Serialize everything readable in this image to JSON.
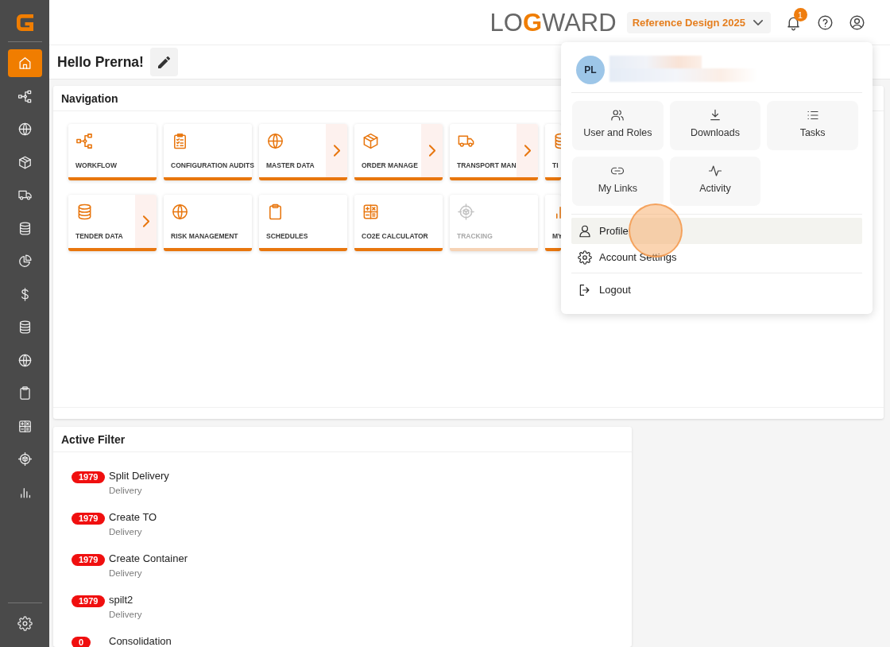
{
  "sidebar": {
    "items": [
      {
        "kind": "home",
        "selected": true
      },
      {
        "kind": "workflow",
        "selected": false
      },
      {
        "kind": "globe",
        "selected": false
      },
      {
        "kind": "box",
        "selected": false
      },
      {
        "kind": "truck",
        "selected": false
      },
      {
        "kind": "database",
        "selected": false
      },
      {
        "kind": "pie",
        "selected": false
      },
      {
        "kind": "dollar",
        "selected": false
      },
      {
        "kind": "database",
        "selected": false
      },
      {
        "kind": "globe",
        "selected": false
      },
      {
        "kind": "clipboard",
        "selected": false
      },
      {
        "kind": "calculator",
        "selected": false
      },
      {
        "kind": "target",
        "selected": false
      },
      {
        "kind": "chart",
        "selected": false
      }
    ],
    "bottom_items": [
      {
        "kind": "settings",
        "selected": false
      }
    ]
  },
  "header": {
    "logo": {
      "lead": "LO",
      "mark": "G",
      "tail": "WARD"
    },
    "project_select": {
      "value": "Reference Design 2025"
    },
    "notifications": {
      "badge": "1"
    }
  },
  "greeting": {
    "title": "Hello Prerna!"
  },
  "navigation": {
    "title": "Navigation",
    "tiles": [
      {
        "label": "WORKFLOW",
        "kind": "workflow",
        "submenu": false,
        "disabled": false
      },
      {
        "label": "CONFIGURATION AUDITS",
        "kind": "checklist",
        "submenu": false,
        "disabled": false
      },
      {
        "label": "MASTER DATA",
        "kind": "globe",
        "submenu": true,
        "disabled": false
      },
      {
        "label": "ORDER MANAGE",
        "kind": "box",
        "submenu": true,
        "disabled": false
      },
      {
        "label": "TRANSPORT MAN",
        "kind": "truck",
        "submenu": true,
        "disabled": false
      },
      {
        "label": "TI",
        "kind": "database",
        "disabled": false
      },
      {
        "label": "TENDER DATA",
        "kind": "database",
        "submenu": true,
        "disabled": false
      },
      {
        "label": "RISK MANAGEMENT",
        "kind": "globe",
        "submenu": false,
        "disabled": false
      },
      {
        "label": "SCHEDULES",
        "kind": "clipboard",
        "submenu": false,
        "disabled": false
      },
      {
        "label": "CO2E CALCULATOR",
        "kind": "calculator",
        "submenu": false,
        "disabled": false
      },
      {
        "label": "TRACKING",
        "kind": "target",
        "submenu": false,
        "disabled": true
      },
      {
        "label": "MY",
        "kind": "chart",
        "disabled": false
      }
    ]
  },
  "active_filter": {
    "title": "Active Filter",
    "filters": [
      {
        "count": "1979",
        "name": "Split Delivery",
        "category": "Delivery"
      },
      {
        "count": "1979",
        "name": "Create TO",
        "category": "Delivery"
      },
      {
        "count": "1979",
        "name": "Create Container",
        "category": "Delivery"
      },
      {
        "count": "1979",
        "name": "spilt2",
        "category": "Delivery"
      },
      {
        "count": "0",
        "name": "Consolidation"
      }
    ]
  },
  "user_menu": {
    "initials": "PL",
    "quick_links": [
      {
        "label": "User and Roles",
        "kind": "users"
      },
      {
        "label": "Downloads",
        "kind": "download"
      },
      {
        "label": "Tasks",
        "kind": "list"
      },
      {
        "label": "My Links",
        "kind": "link"
      },
      {
        "label": "Activity",
        "kind": "activity"
      }
    ],
    "groups": [
      {
        "items": [
          {
            "label": "Profile",
            "kind": "user",
            "selected": true
          },
          {
            "label": "Account Settings",
            "kind": "settings",
            "selected": false
          }
        ]
      },
      {
        "items": [
          {
            "label": "Logout",
            "kind": "logout",
            "selected": false
          }
        ]
      }
    ]
  }
}
